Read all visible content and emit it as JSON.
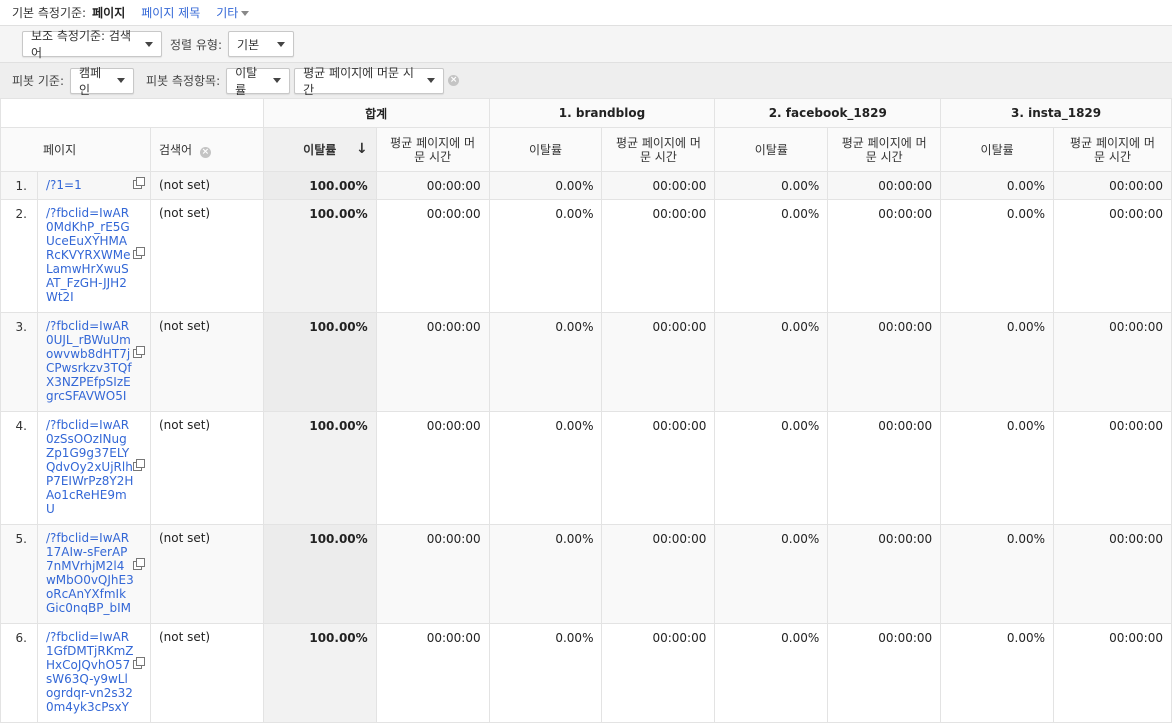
{
  "dimension_bar": {
    "label": "기본 측정기준:",
    "active": "페이지",
    "links": [
      "페이지 제목",
      "기타"
    ]
  },
  "secondary_bar": {
    "secondary_dimension": "보조 측정기준: 검색어",
    "sort_label": "정렬 유형:",
    "sort_value": "기본"
  },
  "pivot_bar": {
    "pivot_by_label": "피봇 기준:",
    "pivot_by_value": "캠페인",
    "pivot_metrics_label": "피봇 측정항목:",
    "metric1": "이탈률",
    "metric2": "평균 페이지에 머문 시간"
  },
  "table": {
    "groups": [
      "합계",
      "1. brandblog",
      "2. facebook_1829",
      "3. insta_1829"
    ],
    "col_page": "페이지",
    "col_keyword": "검색어",
    "metric_bounce": "이탈률",
    "metric_time_line1": "평균 페이지에 머",
    "metric_time_line2": "문 시간",
    "rows": [
      {
        "idx": "1.",
        "page": "/?1=1",
        "kw": "(not set)",
        "vals": [
          "100.00%",
          "00:00:00",
          "0.00%",
          "00:00:00",
          "0.00%",
          "00:00:00",
          "0.00%",
          "00:00:00"
        ]
      },
      {
        "idx": "2.",
        "page": "/?fbclid=IwAR0MdKhP_rE5GUceEuXYHMARcKVYRXWMeLamwHrXwuSAT_FzGH-JJH2Wt2I",
        "kw": "(not set)",
        "vals": [
          "100.00%",
          "00:00:00",
          "0.00%",
          "00:00:00",
          "0.00%",
          "00:00:00",
          "0.00%",
          "00:00:00"
        ]
      },
      {
        "idx": "3.",
        "page": "/?fbclid=IwAR0UJL_rBWuUmowvwb8dHT7jCPwsrkzv3TQfX3NZPEfpSIzEgrcSFAVWO5I",
        "kw": "(not set)",
        "vals": [
          "100.00%",
          "00:00:00",
          "0.00%",
          "00:00:00",
          "0.00%",
          "00:00:00",
          "0.00%",
          "00:00:00"
        ]
      },
      {
        "idx": "4.",
        "page": "/?fbclid=IwAR0zSsOOzINugZp1G9g37ELYQdvOy2xUjRlhP7EIWrPz8Y2HAo1cReHE9mU",
        "kw": "(not set)",
        "vals": [
          "100.00%",
          "00:00:00",
          "0.00%",
          "00:00:00",
          "0.00%",
          "00:00:00",
          "0.00%",
          "00:00:00"
        ]
      },
      {
        "idx": "5.",
        "page": "/?fbclid=IwAR17AIw-sFerAP7nMVrhjM2l4wMbO0vQJhE3oRcAnYXfmIkGic0nqBP_bIM",
        "kw": "(not set)",
        "vals": [
          "100.00%",
          "00:00:00",
          "0.00%",
          "00:00:00",
          "0.00%",
          "00:00:00",
          "0.00%",
          "00:00:00"
        ]
      },
      {
        "idx": "6.",
        "page": "/?fbclid=IwAR1GfDMTjRKmZHxCoJQvhO57sW63Q-y9wLlogrdqr-vn2s320m4yk3cPsxY",
        "kw": "(not set)",
        "vals": [
          "100.00%",
          "00:00:00",
          "0.00%",
          "00:00:00",
          "0.00%",
          "00:00:00",
          "0.00%",
          "00:00:00"
        ]
      }
    ]
  }
}
